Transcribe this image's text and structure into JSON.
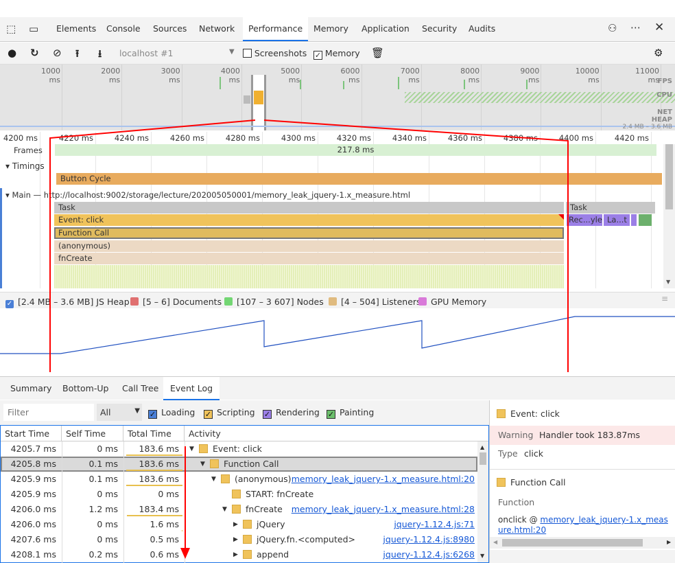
{
  "tabs": [
    "Elements",
    "Console",
    "Sources",
    "Network",
    "Performance",
    "Memory",
    "Application",
    "Security",
    "Audits"
  ],
  "active_tab": "Performance",
  "toolbar": {
    "target": "localhost #1",
    "screenshots_label": "Screenshots",
    "screenshots_checked": false,
    "memory_label": "Memory",
    "memory_checked": true
  },
  "overview": {
    "ticks": [
      "1000 ms",
      "2000 ms",
      "3000 ms",
      "4000 ms",
      "5000 ms",
      "6000 ms",
      "7000 ms",
      "8000 ms",
      "9000 ms",
      "10000 ms",
      "11000 ms"
    ],
    "labels": {
      "fps": "FPS",
      "cpu": "CPU",
      "net": "NET",
      "heap": "HEAP",
      "heap_range": "2.4 MB – 3.6 MB"
    }
  },
  "detail": {
    "ticks": [
      "4200 ms",
      "4220 ms",
      "4240 ms",
      "4260 ms",
      "4280 ms",
      "4300 ms",
      "4320 ms",
      "4340 ms",
      "4360 ms",
      "4380 ms",
      "4400 ms",
      "4420 ms"
    ],
    "frames_label": "Frames",
    "frame_duration": "217.8 ms",
    "timings_label": "Timings",
    "button_cycle": "Button Cycle",
    "main_label": "Main — http://localhost:9002/storage/lecture/202005050001/memory_leak_jquery-1.x_measure.html",
    "task": "Task",
    "task2": "Task",
    "event_click": "Event: click",
    "function_call": "Function Call",
    "anonymous": "(anonymous)",
    "fncreate": "fnCreate",
    "recalc": "Rec...yle",
    "layout": "La...t"
  },
  "memory_legend": [
    {
      "label": "[2.4 MB – 3.6 MB] JS Heap",
      "color": "#4a7fd6",
      "checked": true
    },
    {
      "label": "[5 – 6] Documents",
      "color": "#e07070"
    },
    {
      "label": "[107 – 3 607] Nodes",
      "color": "#73d673"
    },
    {
      "label": "[4 – 504] Listeners",
      "color": "#e0bb7f"
    },
    {
      "label": "GPU Memory",
      "color": "#d97ad9"
    }
  ],
  "bottom_tabs": [
    "Summary",
    "Bottom-Up",
    "Call Tree",
    "Event Log"
  ],
  "active_bottom_tab": "Event Log",
  "filter": {
    "placeholder": "Filter",
    "select": "All",
    "categories": [
      {
        "label": "Loading",
        "color": "#4a7fd6",
        "checked": true
      },
      {
        "label": "Scripting",
        "color": "#f0c35b",
        "checked": true
      },
      {
        "label": "Rendering",
        "color": "#9b7fe6",
        "checked": true
      },
      {
        "label": "Painting",
        "color": "#6cbf6c",
        "checked": true
      }
    ]
  },
  "table": {
    "headers": [
      "Start Time",
      "Self Time",
      "Total Time",
      "Activity"
    ],
    "rows": [
      {
        "start": "4205.7 ms",
        "self": "0 ms",
        "total": "183.6 ms",
        "activity": "Event: click",
        "level": 0,
        "arrow": "down",
        "link": "",
        "bar": 1.0
      },
      {
        "start": "4205.8 ms",
        "self": "0.1 ms",
        "total": "183.6 ms",
        "activity": "Function Call",
        "level": 1,
        "arrow": "down",
        "link": "",
        "bar": 1.0,
        "selected": true
      },
      {
        "start": "4205.9 ms",
        "self": "0.1 ms",
        "total": "183.6 ms",
        "activity": "(anonymous)",
        "level": 2,
        "arrow": "down",
        "link": "memory_leak_jquery-1.x_measure.html:20",
        "bar": 1.0
      },
      {
        "start": "4205.9 ms",
        "self": "0 ms",
        "total": "0 ms",
        "activity": "START: fnCreate",
        "level": 3,
        "arrow": "",
        "link": "",
        "bar": 0
      },
      {
        "start": "4206.0 ms",
        "self": "1.2 ms",
        "total": "183.4 ms",
        "activity": "fnCreate",
        "level": 3,
        "arrow": "down",
        "link": "memory_leak_jquery-1.x_measure.html:28",
        "bar": 0.99
      },
      {
        "start": "4206.0 ms",
        "self": "0 ms",
        "total": "1.6 ms",
        "activity": "jQuery",
        "level": 4,
        "arrow": "right",
        "link": "jquery-1.12.4.js:71",
        "bar": 0.01
      },
      {
        "start": "4207.6 ms",
        "self": "0 ms",
        "total": "0.5 ms",
        "activity": "jQuery.fn.<computed>",
        "level": 4,
        "arrow": "right",
        "link": "jquery-1.12.4.js:8980",
        "bar": 0
      },
      {
        "start": "4208.1 ms",
        "self": "0.2 ms",
        "total": "0.6 ms",
        "activity": "append",
        "level": 4,
        "arrow": "right",
        "link": "jquery-1.12.4.js:6268",
        "bar": 0
      }
    ]
  },
  "details": {
    "event_title": "Event: click",
    "warning_label": "Warning",
    "warning_value": "Handler took 183.87ms",
    "type_label": "Type",
    "type_value": "click",
    "fc_title": "Function Call",
    "function_label": "Function",
    "onclick_prefix": "onclick @ ",
    "onclick_link": "memory_leak_jquery-1.x_measure.html:20"
  },
  "colors": {
    "accent": "#1a73e8",
    "scripting": "#f0c35b",
    "button_cycle": "#e8ab5e",
    "task": "#c8c8c8",
    "frame": "#d8f0d3",
    "warning_bg": "#fce8e8",
    "annotation": "#ff0000"
  }
}
